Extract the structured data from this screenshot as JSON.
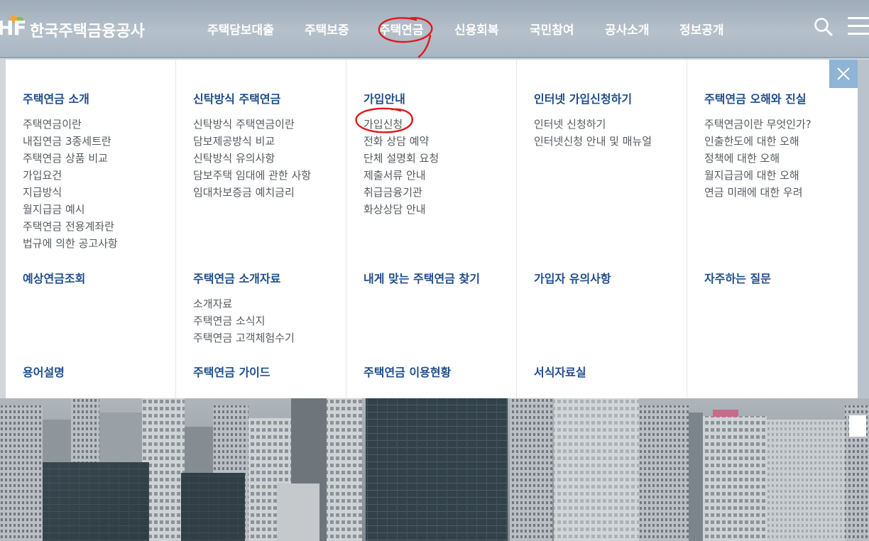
{
  "brand": {
    "logo_mark": "HF",
    "name": "한국주택금융공사"
  },
  "gnb": [
    {
      "label": "주택담보대출"
    },
    {
      "label": "주택보증"
    },
    {
      "label": "주택연금",
      "active": true
    },
    {
      "label": "신용회복"
    },
    {
      "label": "국민참여"
    },
    {
      "label": "공사소개"
    },
    {
      "label": "정보공개"
    }
  ],
  "header_icons": {
    "search": "search-icon",
    "menu": "hamburger-menu-icon"
  },
  "close_icon": "close-icon",
  "menu": {
    "col1": {
      "s1": {
        "title": "주택연금 소개",
        "items": [
          "주택연금이란",
          "내집연금 3종세트란",
          "주택연금 상품 비교",
          "가입요건",
          "지급방식",
          "월지급금 예시",
          "주택연금 전용계좌란",
          "법규에 의한 공고사항"
        ]
      },
      "s2": {
        "title": "예상연금조회"
      },
      "s3": {
        "title": "용어설명"
      }
    },
    "col2": {
      "s1": {
        "title": "신탁방식 주택연금",
        "items": [
          "신탁방식 주택연금이란",
          "담보제공방식 비교",
          "신탁방식 유의사항",
          "담보주택 임대에 관한 사항",
          "임대차보증금 예치금리"
        ]
      },
      "s2": {
        "title": "주택연금 소개자료",
        "items": [
          "소개자료",
          "주택연금 소식지",
          "주택연금 고객체험수기"
        ]
      },
      "s3": {
        "title": "주택연금 가이드"
      }
    },
    "col3": {
      "s1": {
        "title": "가입안내",
        "items": [
          "가입신청",
          "전화 상담 예약",
          "단체 설명회 요청",
          "제출서류 안내",
          "취급금융기관",
          "화상상담 안내"
        ]
      },
      "s2": {
        "title": "내게 맞는 주택연금 찾기"
      },
      "s3": {
        "title": "주택연금 이용현황"
      }
    },
    "col4": {
      "s1": {
        "title": "인터넷 가입신청하기",
        "items": [
          "인터넷 신청하기",
          "인터넷신청 안내 및 매뉴얼"
        ]
      },
      "s2": {
        "title": "가입자 유의사항"
      },
      "s3": {
        "title": "서식자료실"
      }
    },
    "col5": {
      "s1": {
        "title": "주택연금 오해와 진실",
        "items": [
          "주택연금이란 무엇인가?",
          "인출한도에 대한 오해",
          "정책에 대한 오해",
          "월지급금에 대한 오해",
          "연금 미래에 대한 우려"
        ]
      },
      "s2": {
        "title": "자주하는 질문"
      }
    }
  },
  "colors": {
    "title": "#1f4d8c",
    "item": "#555a60",
    "annotation": "#e0181b",
    "close_bg": "#8fb4d6"
  }
}
